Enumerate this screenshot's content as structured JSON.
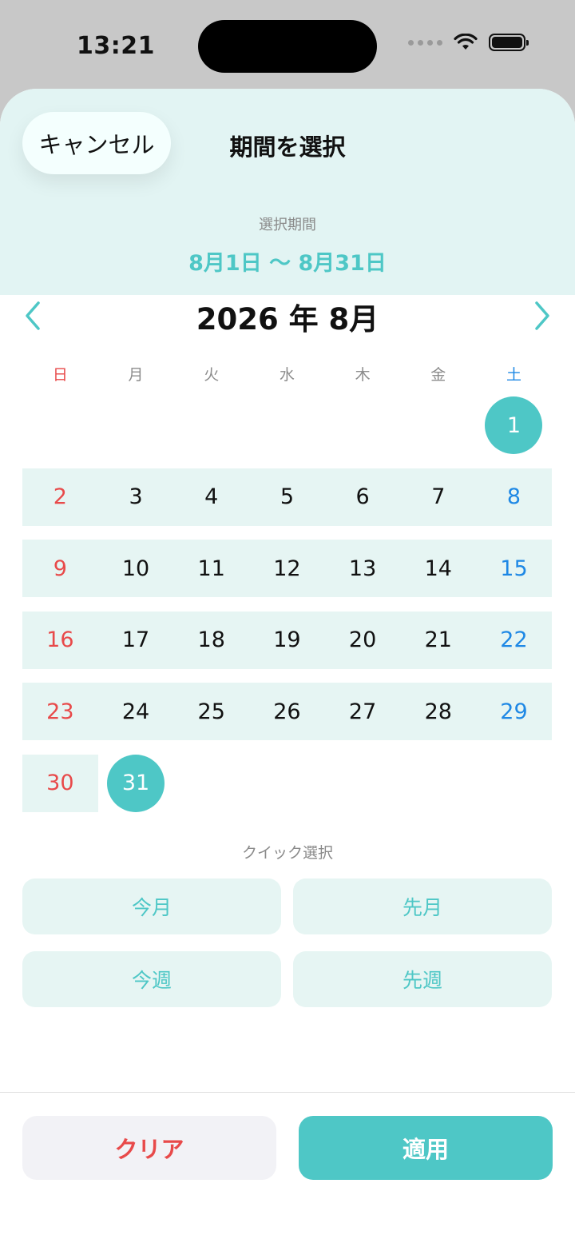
{
  "status_bar": {
    "time": "13:21"
  },
  "header": {
    "cancel_label": "キャンセル",
    "title": "期間を選択",
    "range_label": "選択期間",
    "range_value": "8月1日 〜 8月31日"
  },
  "calendar": {
    "month_title": "2026 年 8月",
    "weekdays": [
      "日",
      "月",
      "火",
      "水",
      "木",
      "金",
      "土"
    ],
    "weeks": [
      [
        "",
        "",
        "",
        "",
        "",
        "",
        "1"
      ],
      [
        "2",
        "3",
        "4",
        "5",
        "6",
        "7",
        "8"
      ],
      [
        "9",
        "10",
        "11",
        "12",
        "13",
        "14",
        "15"
      ],
      [
        "16",
        "17",
        "18",
        "19",
        "20",
        "21",
        "22"
      ],
      [
        "23",
        "24",
        "25",
        "26",
        "27",
        "28",
        "29"
      ],
      [
        "30",
        "31",
        "",
        "",
        "",
        "",
        ""
      ]
    ],
    "range_start": "1",
    "range_end": "31"
  },
  "quick_select": {
    "label": "クイック選択",
    "this_month": "今月",
    "last_month": "先月",
    "this_week": "今週",
    "last_week": "先週"
  },
  "footer": {
    "clear_label": "クリア",
    "apply_label": "適用"
  },
  "colors": {
    "accent": "#4ec7c6",
    "range_band": "#e6f5f3",
    "sunday": "#e84a4a",
    "saturday": "#1e88e5"
  }
}
